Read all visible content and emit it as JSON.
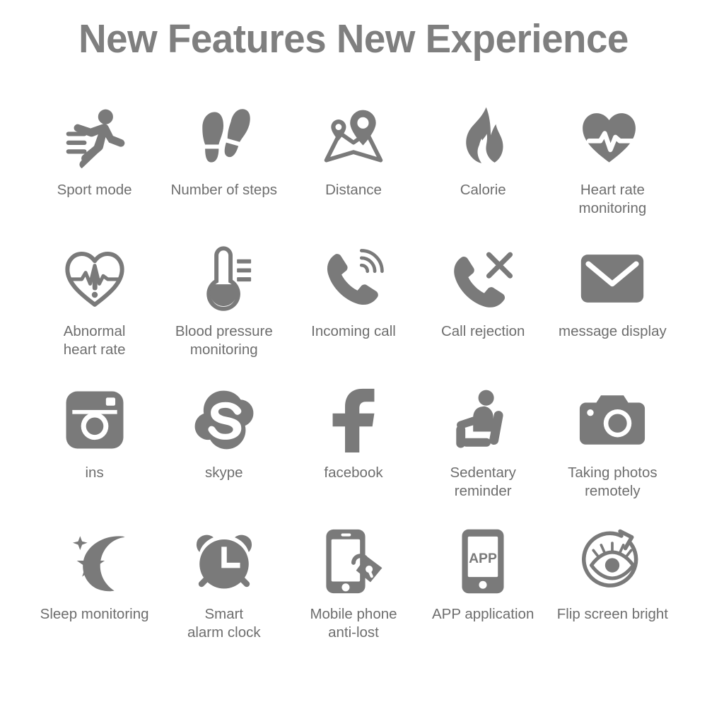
{
  "page": {
    "title": "New Features New Experience",
    "background_color": "#ffffff",
    "icon_color": "#7a7a7a",
    "label_color": "#6e6e6e",
    "title_color": "#7f7f7f",
    "columns": 5,
    "rows": 4
  },
  "features": [
    {
      "label": "Sport mode",
      "icon": "running-person-icon"
    },
    {
      "label": "Number of steps",
      "icon": "footprints-icon"
    },
    {
      "label": "Distance",
      "icon": "map-pins-icon"
    },
    {
      "label": "Calorie",
      "icon": "flame-icon"
    },
    {
      "label": "Heart rate\nmonitoring",
      "icon": "heart-pulse-filled-icon"
    },
    {
      "label": "Abnormal\nheart rate",
      "icon": "heart-alert-outline-icon"
    },
    {
      "label": "Blood pressure\nmonitoring",
      "icon": "thermometer-icon"
    },
    {
      "label": "Incoming call",
      "icon": "phone-ringing-icon"
    },
    {
      "label": "Call rejection",
      "icon": "phone-missed-icon"
    },
    {
      "label": "message display",
      "icon": "envelope-icon"
    },
    {
      "label": "ins",
      "icon": "instagram-camera-icon"
    },
    {
      "label": "skype",
      "icon": "skype-icon"
    },
    {
      "label": "facebook",
      "icon": "facebook-f-icon"
    },
    {
      "label": "Sedentary\nreminder",
      "icon": "seated-person-icon"
    },
    {
      "label": "Taking photos\nremotely",
      "icon": "camera-icon"
    },
    {
      "label": "Sleep monitoring",
      "icon": "moon-stars-icon"
    },
    {
      "label": "Smart\nalarm clock",
      "icon": "alarm-clock-icon"
    },
    {
      "label": "Mobile phone\nanti-lost",
      "icon": "phone-lock-icon"
    },
    {
      "label": "APP application",
      "icon": "phone-app-icon"
    },
    {
      "label": "Flip screen bright",
      "icon": "eye-rotate-icon"
    }
  ],
  "icon_text": {
    "app_screen_label": "APP"
  }
}
